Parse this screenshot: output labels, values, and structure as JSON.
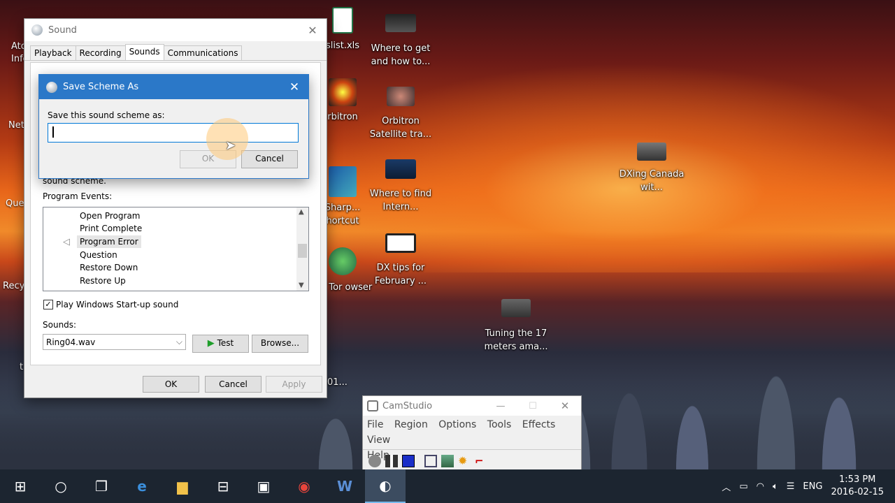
{
  "desktop": {
    "icons": [
      {
        "label": "Where to get and how to..."
      },
      {
        "label": "Orbitron Satellite tra..."
      },
      {
        "label": "Where to find Intern..."
      },
      {
        "label": "DX tips for February ..."
      },
      {
        "label": "Tuning the 17 meters ama..."
      },
      {
        "label": "DXing Canada wit..."
      },
      {
        "label": "slist.xls"
      },
      {
        "label": "rbitron"
      },
      {
        "label": "Sharp... hortcut"
      },
      {
        "label": "art Tor owser"
      },
      {
        "label": "01..."
      }
    ],
    "left_edge": [
      "Ato Infor",
      "Netw",
      "Que",
      "Recy",
      "t"
    ]
  },
  "sound_window": {
    "title": "Sound",
    "tabs": [
      "Playback",
      "Recording",
      "Sounds",
      "Communications"
    ],
    "active_tab": "Sounds",
    "partial_text": "sound scheme.",
    "program_events_label": "Program Events:",
    "events": [
      "Open Program",
      "Print Complete",
      "Program Error",
      "Question",
      "Restore Down",
      "Restore Up"
    ],
    "selected_event": "Program Error",
    "startup_checkbox_label": "Play Windows Start-up sound",
    "startup_checked": true,
    "sounds_label": "Sounds:",
    "sound_value": "Ring04.wav",
    "test_label": "Test",
    "browse_label": "Browse...",
    "ok_label": "OK",
    "cancel_label": "Cancel",
    "apply_label": "Apply"
  },
  "save_dialog": {
    "title": "Save Scheme As",
    "prompt": "Save this sound scheme as:",
    "input_value": "",
    "ok_label": "OK",
    "cancel_label": "Cancel"
  },
  "camstudio": {
    "title": "CamStudio",
    "menu": [
      "File",
      "Region",
      "Options",
      "Tools",
      "Effects",
      "View",
      "Help"
    ]
  },
  "taskbar": {
    "language": "ENG",
    "time": "1:53 PM",
    "date": "2016-02-15"
  },
  "colors": {
    "accent": "#2b78c8",
    "taskbar": "#1c2530"
  }
}
